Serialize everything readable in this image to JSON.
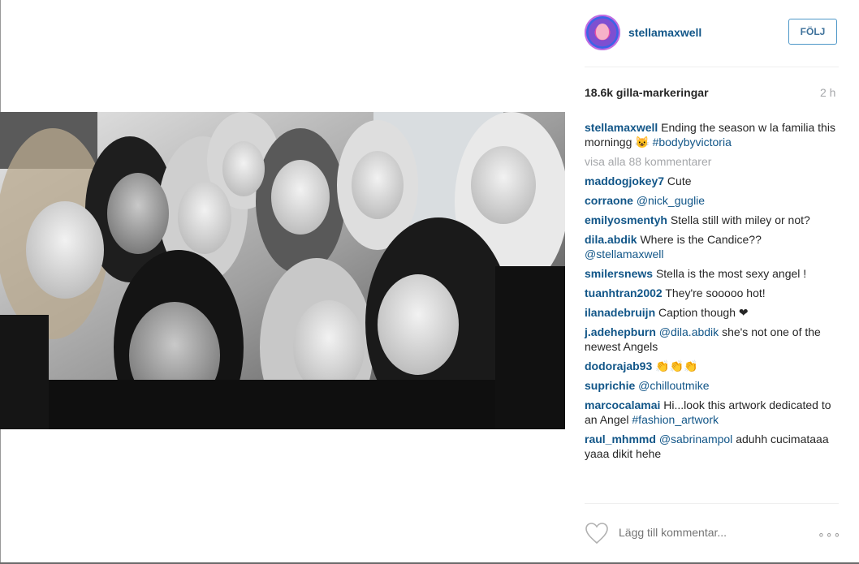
{
  "post": {
    "username": "stellamaxwell",
    "follow_label": "FÖLJ",
    "likes": "18.6k gilla-markeringar",
    "time": "2 h",
    "caption": {
      "user": "stellamaxwell",
      "text": "Ending the season w la familia this morningg 😺",
      "hashtag": "#bodybyvictoria"
    },
    "view_all": "visa alla 88 kommentarer",
    "add_comment_placeholder": "Lägg till kommentar...",
    "more_label": "∘∘∘"
  },
  "comments": [
    {
      "user": "maddogjokey7",
      "text": "Cute",
      "link": ""
    },
    {
      "user": "corraone",
      "text": "",
      "link": "@nick_guglie"
    },
    {
      "user": "emilyosmentyh",
      "text": "Stella still with miley or not?",
      "link": ""
    },
    {
      "user": "dila.abdik",
      "text": "Where is the Candice??",
      "link": "@stellamaxwell"
    },
    {
      "user": "smilersnews",
      "text": "Stella is the most sexy angel !",
      "link": ""
    },
    {
      "user": "tuanhtran2002",
      "text": "They're sooooo hot!",
      "link": ""
    },
    {
      "user": "ilanadebruijn",
      "text": "Caption though ❤",
      "link": ""
    },
    {
      "user": "j.adehepburn",
      "text": "she's not one of the newest Angels",
      "link": "@dila.abdik"
    },
    {
      "user": "dodorajab93",
      "text": "👏👏👏",
      "link": ""
    },
    {
      "user": "suprichie",
      "text": "",
      "link": "@chilloutmike"
    },
    {
      "user": "marcocalamai",
      "text": "Hi...look this artwork dedicated to an Angel",
      "link": "#fashion_artwork"
    },
    {
      "user": "raul_mhmmd",
      "text": "aduhh cucimataaa yaaa dikit hehe",
      "link": "@sabrinampol"
    }
  ],
  "colors": {
    "link": "#125688",
    "muted": "#a5a7aa",
    "button_border": "#4d97c8"
  },
  "icons": {
    "heart": "heart-outline-icon",
    "more": "more-options-icon"
  }
}
